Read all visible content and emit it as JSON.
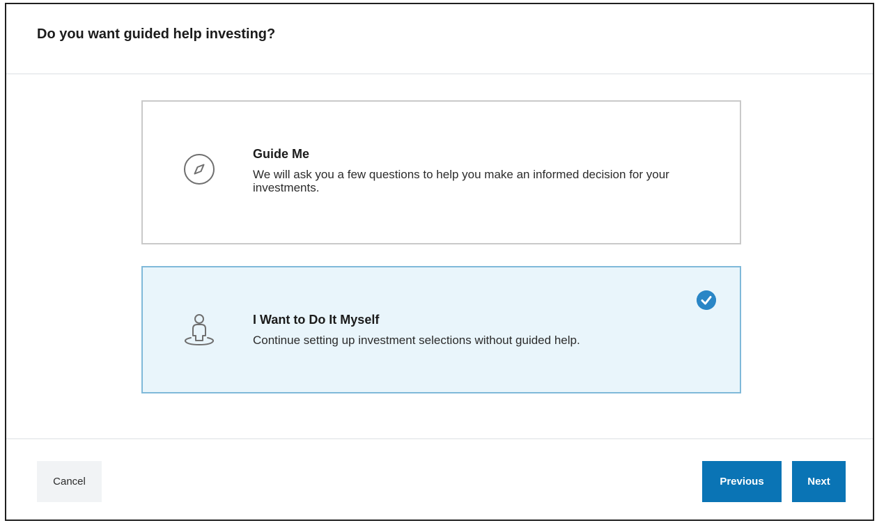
{
  "dialog": {
    "title": "Do you want guided help investing?"
  },
  "options": [
    {
      "icon": "compass-icon",
      "title": "Guide Me",
      "description": "We will ask you a few questions to help you make an informed decision for your investments.",
      "selected": false
    },
    {
      "icon": "person-standing-icon",
      "title": "I Want to Do It Myself",
      "description": "Continue setting up investment selections without guided help.",
      "selected": true
    }
  ],
  "footer": {
    "cancel_label": "Cancel",
    "previous_label": "Previous",
    "next_label": "Next"
  },
  "colors": {
    "primary": "#0a74b5",
    "selected_bg": "#e9f5fb",
    "selected_border": "#7fb9d9",
    "check": "#2a86c6"
  }
}
